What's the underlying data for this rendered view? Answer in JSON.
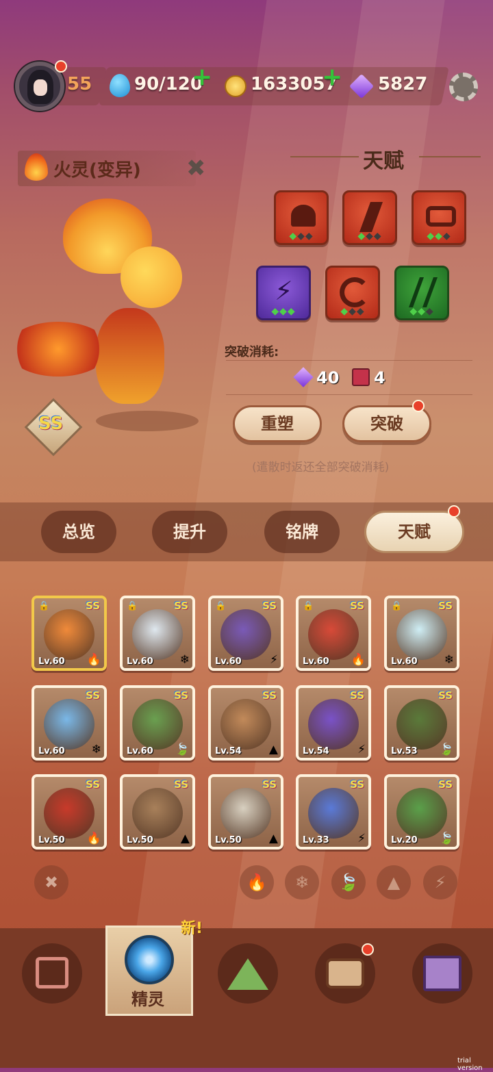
{
  "top": {
    "level": "55",
    "energy": "90/120",
    "coins": "1633057",
    "gems": "5827"
  },
  "spirit": {
    "name": "火灵(变异)",
    "grade": "SS"
  },
  "talent": {
    "title": "天赋",
    "breakthrough_label": "突破消耗:",
    "cost_gems": "40",
    "cost_item": "4",
    "reset_btn": "重塑",
    "break_btn": "突破",
    "note": "(遣散时返还全部突破消耗)"
  },
  "tabs": [
    "总览",
    "提升",
    "铭牌",
    "天赋"
  ],
  "cards": [
    {
      "lv": "Lv.60",
      "ss": "SS",
      "el": "🔥"
    },
    {
      "lv": "Lv.60",
      "ss": "SS",
      "el": "❄"
    },
    {
      "lv": "Lv.60",
      "ss": "SS",
      "el": "⚡"
    },
    {
      "lv": "Lv.60",
      "ss": "SS",
      "el": "🔥"
    },
    {
      "lv": "Lv.60",
      "ss": "SS",
      "el": "❄"
    },
    {
      "lv": "Lv.60",
      "ss": "SS",
      "el": "❄"
    },
    {
      "lv": "Lv.60",
      "ss": "SS",
      "el": "🍃"
    },
    {
      "lv": "Lv.54",
      "ss": "SS",
      "el": "▲"
    },
    {
      "lv": "Lv.54",
      "ss": "SS",
      "el": "⚡"
    },
    {
      "lv": "Lv.53",
      "ss": "SS",
      "el": "🍃"
    },
    {
      "lv": "Lv.50",
      "ss": "SS",
      "el": "🔥"
    },
    {
      "lv": "Lv.50",
      "ss": "SS",
      "el": "▲"
    },
    {
      "lv": "Lv.50",
      "ss": "SS",
      "el": "▲"
    },
    {
      "lv": "Lv.33",
      "ss": "SS",
      "el": "⚡"
    },
    {
      "lv": "Lv.20",
      "ss": "SS",
      "el": "🍃"
    }
  ],
  "nav": {
    "active_label": "精灵",
    "new_badge": "新!"
  },
  "watermark": "trial version"
}
